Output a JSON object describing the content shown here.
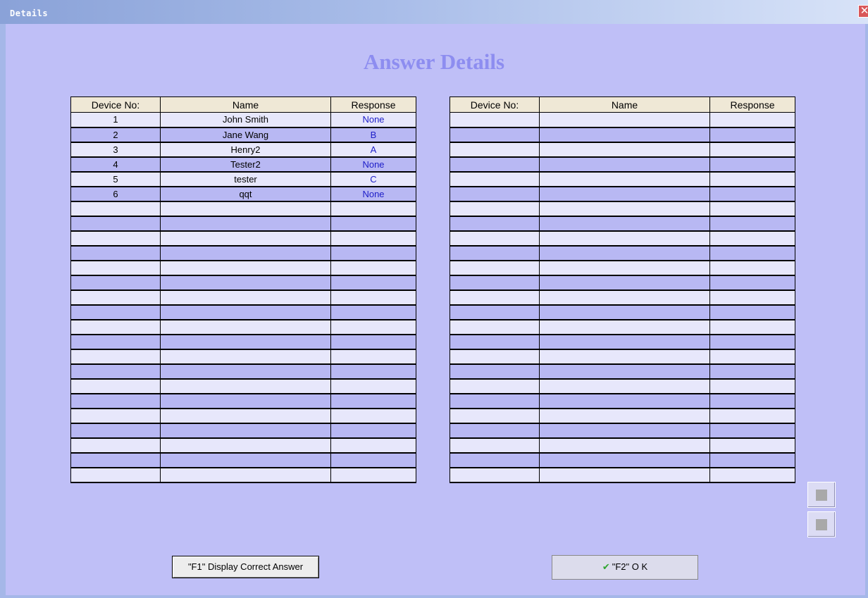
{
  "window": {
    "title": "Details",
    "close_glyph": "✕"
  },
  "heading": "Answer Details",
  "table": {
    "columns": [
      "Device No:",
      "Name",
      "Response"
    ],
    "left_rows": [
      [
        "1",
        "John Smith",
        "None"
      ],
      [
        "2",
        "Jane Wang",
        "B"
      ],
      [
        "3",
        "Henry2",
        "A"
      ],
      [
        "4",
        "Tester2",
        "None"
      ],
      [
        "5",
        "tester",
        "C"
      ],
      [
        "6",
        "qqt",
        "None"
      ],
      [
        "",
        "",
        ""
      ],
      [
        "",
        "",
        ""
      ],
      [
        "",
        "",
        ""
      ],
      [
        "",
        "",
        ""
      ],
      [
        "",
        "",
        ""
      ],
      [
        "",
        "",
        ""
      ],
      [
        "",
        "",
        ""
      ],
      [
        "",
        "",
        ""
      ],
      [
        "",
        "",
        ""
      ],
      [
        "",
        "",
        ""
      ],
      [
        "",
        "",
        ""
      ],
      [
        "",
        "",
        ""
      ],
      [
        "",
        "",
        ""
      ],
      [
        "",
        "",
        ""
      ],
      [
        "",
        "",
        ""
      ],
      [
        "",
        "",
        ""
      ],
      [
        "",
        "",
        ""
      ],
      [
        "",
        "",
        ""
      ],
      [
        "",
        "",
        ""
      ]
    ],
    "right_rows": [
      [
        "",
        "",
        ""
      ],
      [
        "",
        "",
        ""
      ],
      [
        "",
        "",
        ""
      ],
      [
        "",
        "",
        ""
      ],
      [
        "",
        "",
        ""
      ],
      [
        "",
        "",
        ""
      ],
      [
        "",
        "",
        ""
      ],
      [
        "",
        "",
        ""
      ],
      [
        "",
        "",
        ""
      ],
      [
        "",
        "",
        ""
      ],
      [
        "",
        "",
        ""
      ],
      [
        "",
        "",
        ""
      ],
      [
        "",
        "",
        ""
      ],
      [
        "",
        "",
        ""
      ],
      [
        "",
        "",
        ""
      ],
      [
        "",
        "",
        ""
      ],
      [
        "",
        "",
        ""
      ],
      [
        "",
        "",
        ""
      ],
      [
        "",
        "",
        ""
      ],
      [
        "",
        "",
        ""
      ],
      [
        "",
        "",
        ""
      ],
      [
        "",
        "",
        ""
      ],
      [
        "",
        "",
        ""
      ],
      [
        "",
        "",
        ""
      ],
      [
        "",
        "",
        ""
      ]
    ]
  },
  "buttons": {
    "display_correct": "\"F1\"  Display Correct Answer",
    "ok": "\"F2\" O K",
    "ok_icon": "checkmark-icon"
  },
  "colors": {
    "background": "#bfbff7",
    "heading": "#8d8df0",
    "row_light": "#e7e7fb",
    "row_dark": "#b8b8f3",
    "header_bg": "#efe8d6",
    "response_text": "#1d1dc8"
  }
}
